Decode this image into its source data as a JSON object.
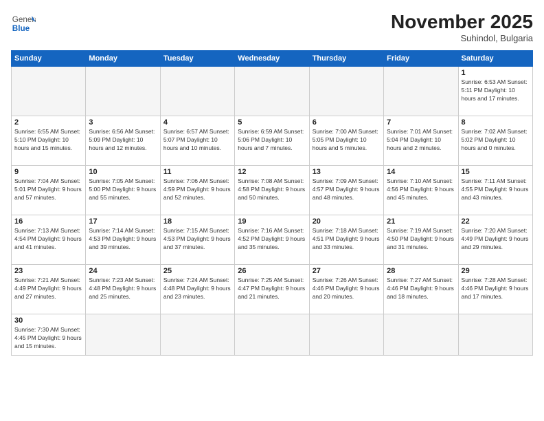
{
  "header": {
    "logo_general": "General",
    "logo_blue": "Blue",
    "month_year": "November 2025",
    "location": "Suhindol, Bulgaria"
  },
  "weekdays": [
    "Sunday",
    "Monday",
    "Tuesday",
    "Wednesday",
    "Thursday",
    "Friday",
    "Saturday"
  ],
  "weeks": [
    [
      {
        "day": "",
        "info": ""
      },
      {
        "day": "",
        "info": ""
      },
      {
        "day": "",
        "info": ""
      },
      {
        "day": "",
        "info": ""
      },
      {
        "day": "",
        "info": ""
      },
      {
        "day": "",
        "info": ""
      },
      {
        "day": "1",
        "info": "Sunrise: 6:53 AM\nSunset: 5:11 PM\nDaylight: 10 hours and 17 minutes."
      }
    ],
    [
      {
        "day": "2",
        "info": "Sunrise: 6:55 AM\nSunset: 5:10 PM\nDaylight: 10 hours and 15 minutes."
      },
      {
        "day": "3",
        "info": "Sunrise: 6:56 AM\nSunset: 5:09 PM\nDaylight: 10 hours and 12 minutes."
      },
      {
        "day": "4",
        "info": "Sunrise: 6:57 AM\nSunset: 5:07 PM\nDaylight: 10 hours and 10 minutes."
      },
      {
        "day": "5",
        "info": "Sunrise: 6:59 AM\nSunset: 5:06 PM\nDaylight: 10 hours and 7 minutes."
      },
      {
        "day": "6",
        "info": "Sunrise: 7:00 AM\nSunset: 5:05 PM\nDaylight: 10 hours and 5 minutes."
      },
      {
        "day": "7",
        "info": "Sunrise: 7:01 AM\nSunset: 5:04 PM\nDaylight: 10 hours and 2 minutes."
      },
      {
        "day": "8",
        "info": "Sunrise: 7:02 AM\nSunset: 5:02 PM\nDaylight: 10 hours and 0 minutes."
      }
    ],
    [
      {
        "day": "9",
        "info": "Sunrise: 7:04 AM\nSunset: 5:01 PM\nDaylight: 9 hours and 57 minutes."
      },
      {
        "day": "10",
        "info": "Sunrise: 7:05 AM\nSunset: 5:00 PM\nDaylight: 9 hours and 55 minutes."
      },
      {
        "day": "11",
        "info": "Sunrise: 7:06 AM\nSunset: 4:59 PM\nDaylight: 9 hours and 52 minutes."
      },
      {
        "day": "12",
        "info": "Sunrise: 7:08 AM\nSunset: 4:58 PM\nDaylight: 9 hours and 50 minutes."
      },
      {
        "day": "13",
        "info": "Sunrise: 7:09 AM\nSunset: 4:57 PM\nDaylight: 9 hours and 48 minutes."
      },
      {
        "day": "14",
        "info": "Sunrise: 7:10 AM\nSunset: 4:56 PM\nDaylight: 9 hours and 45 minutes."
      },
      {
        "day": "15",
        "info": "Sunrise: 7:11 AM\nSunset: 4:55 PM\nDaylight: 9 hours and 43 minutes."
      }
    ],
    [
      {
        "day": "16",
        "info": "Sunrise: 7:13 AM\nSunset: 4:54 PM\nDaylight: 9 hours and 41 minutes."
      },
      {
        "day": "17",
        "info": "Sunrise: 7:14 AM\nSunset: 4:53 PM\nDaylight: 9 hours and 39 minutes."
      },
      {
        "day": "18",
        "info": "Sunrise: 7:15 AM\nSunset: 4:53 PM\nDaylight: 9 hours and 37 minutes."
      },
      {
        "day": "19",
        "info": "Sunrise: 7:16 AM\nSunset: 4:52 PM\nDaylight: 9 hours and 35 minutes."
      },
      {
        "day": "20",
        "info": "Sunrise: 7:18 AM\nSunset: 4:51 PM\nDaylight: 9 hours and 33 minutes."
      },
      {
        "day": "21",
        "info": "Sunrise: 7:19 AM\nSunset: 4:50 PM\nDaylight: 9 hours and 31 minutes."
      },
      {
        "day": "22",
        "info": "Sunrise: 7:20 AM\nSunset: 4:49 PM\nDaylight: 9 hours and 29 minutes."
      }
    ],
    [
      {
        "day": "23",
        "info": "Sunrise: 7:21 AM\nSunset: 4:49 PM\nDaylight: 9 hours and 27 minutes."
      },
      {
        "day": "24",
        "info": "Sunrise: 7:23 AM\nSunset: 4:48 PM\nDaylight: 9 hours and 25 minutes."
      },
      {
        "day": "25",
        "info": "Sunrise: 7:24 AM\nSunset: 4:48 PM\nDaylight: 9 hours and 23 minutes."
      },
      {
        "day": "26",
        "info": "Sunrise: 7:25 AM\nSunset: 4:47 PM\nDaylight: 9 hours and 21 minutes."
      },
      {
        "day": "27",
        "info": "Sunrise: 7:26 AM\nSunset: 4:46 PM\nDaylight: 9 hours and 20 minutes."
      },
      {
        "day": "28",
        "info": "Sunrise: 7:27 AM\nSunset: 4:46 PM\nDaylight: 9 hours and 18 minutes."
      },
      {
        "day": "29",
        "info": "Sunrise: 7:28 AM\nSunset: 4:46 PM\nDaylight: 9 hours and 17 minutes."
      }
    ],
    [
      {
        "day": "30",
        "info": "Sunrise: 7:30 AM\nSunset: 4:45 PM\nDaylight: 9 hours and 15 minutes."
      },
      {
        "day": "",
        "info": ""
      },
      {
        "day": "",
        "info": ""
      },
      {
        "day": "",
        "info": ""
      },
      {
        "day": "",
        "info": ""
      },
      {
        "day": "",
        "info": ""
      },
      {
        "day": "",
        "info": ""
      }
    ]
  ]
}
